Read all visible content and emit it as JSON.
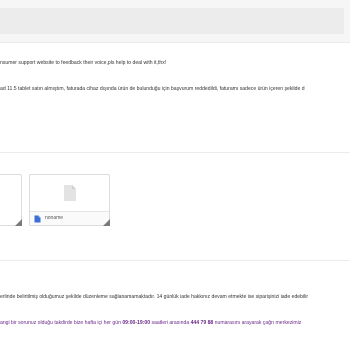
{
  "lines": {
    "support": "nsumer support website to feedback  their voice,pls help to deal with it,thx!",
    "complaint": "ad 11.5 tablet satın almıştım, faturada cihaz dışında ürün de bulunduğu için başvurum reddedildi, faturamı sadece ürün içeren şekilde d",
    "policy": "erlinde belirtilmiş olduğumuz şekilde düzenleme sağlanamamaktadır. 14 günlük iade hakkınız devam etmekte ise siparişinizi iade edebilir",
    "contact_a": "angi bir sorunuz olduğu takdirde bize hafta içi her gün ",
    "contact_hours": "09:00-19:00",
    "contact_b": " saatleri arasında ",
    "contact_phone": "444 79 88",
    "contact_c": " numarasını arayarak çağrı merkezimiz"
  },
  "attachment": {
    "name": "noname",
    "icon": "document-icon"
  },
  "colors": {
    "accent": "#6a2a8a",
    "file_icon": "#3b6fd6"
  }
}
